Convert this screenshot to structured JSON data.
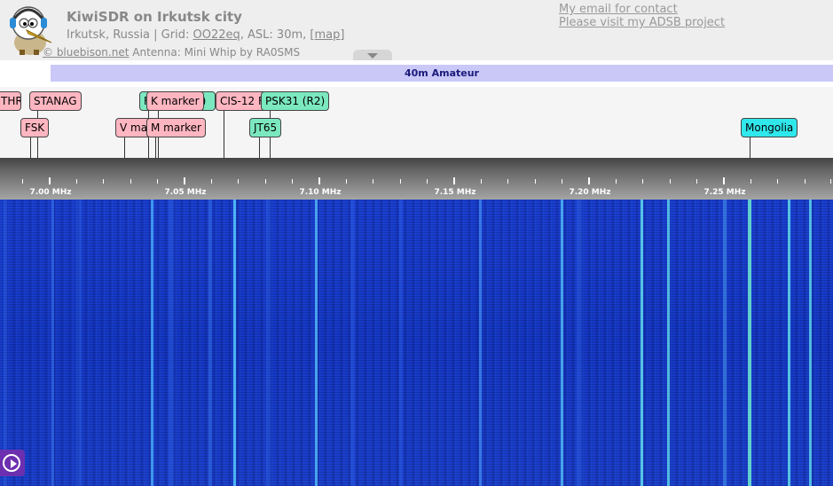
{
  "header": {
    "title": "KiwiSDR on Irkutsk city",
    "location": "Irkutsk, Russia",
    "grid_prefix": "| Grid:",
    "grid": "OO22eq",
    "asl": ", ASL: 30m,",
    "map_link": "[map]",
    "credit_link": "© bluebison.net",
    "antenna": "Antenna: Mini Whip by RA0SMS",
    "email_link": "My email for contact",
    "adsb_link": "Please visit my ADSB project"
  },
  "band": {
    "label": "40m Amateur"
  },
  "markers": {
    "thr": "THR",
    "stanag": "STANAG",
    "fsk": "FSK",
    "f_partial": "F",
    "three": "3)",
    "k_marker": "K marker",
    "v_marker": "V marker",
    "m_marker": "M marker",
    "cis12": "CIS-12 F",
    "psk31": "PSK31 (R2)",
    "jt65": "JT65",
    "mongolia": "Mongolia"
  },
  "scale": {
    "labels": [
      "7.00 MHz",
      "7.05 MHz",
      "7.10 MHz",
      "7.15 MHz",
      "7.20 MHz",
      "7.25 MHz"
    ]
  },
  "colors": {
    "waterfall_bg": "#1538c4",
    "signal_cyan": "#4fe0e8",
    "marker_pink": "#ffb6c1",
    "marker_green": "#7be8c0",
    "marker_cyan": "#2fe8ec",
    "band_bar": "#c9c8f7"
  },
  "icons": {
    "logo": "kiwi-bird-logo",
    "toggle": "chevron-down-icon",
    "play": "play-icon"
  }
}
